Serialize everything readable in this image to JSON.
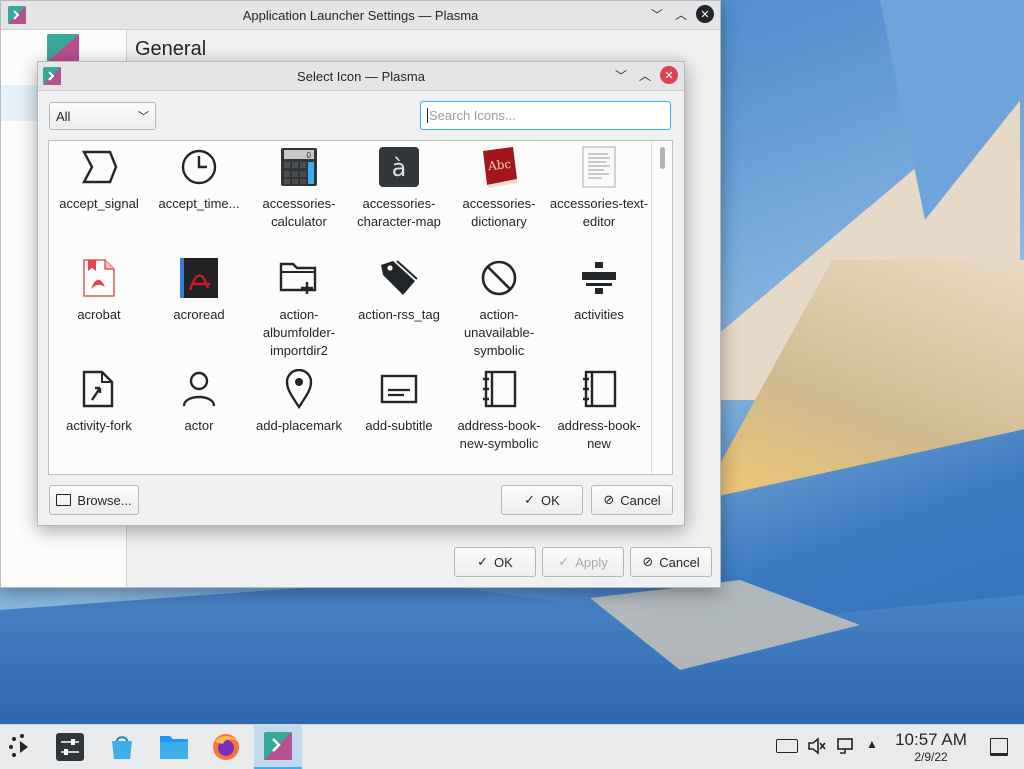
{
  "parent_window": {
    "title": "Application Launcher Settings — Plasma",
    "heading": "General",
    "ok_label": "OK",
    "apply_label": "Apply",
    "cancel_label": "Cancel"
  },
  "dialog": {
    "title": "Select Icon — Plasma",
    "category_selected": "All",
    "search_placeholder": "Search Icons...",
    "browse_label": "Browse...",
    "ok_label": "OK",
    "cancel_label": "Cancel",
    "icons": [
      {
        "label": "accept_signal",
        "icon": "sigma-icon"
      },
      {
        "label": "accept_time...",
        "icon": "clock-icon"
      },
      {
        "label": "accessories-calculator",
        "icon": "calculator-icon"
      },
      {
        "label": "accessories-character-map",
        "icon": "character-map-icon"
      },
      {
        "label": "accessories-dictionary",
        "icon": "dictionary-icon"
      },
      {
        "label": "accessories-text-editor",
        "icon": "text-editor-icon"
      },
      {
        "label": "acrobat",
        "icon": "acrobat-icon"
      },
      {
        "label": "acroread",
        "icon": "acroread-icon"
      },
      {
        "label": "action-albumfolder-importdir2",
        "icon": "folder-add-icon"
      },
      {
        "label": "action-rss_tag",
        "icon": "tag-icon"
      },
      {
        "label": "action-unavailable-symbolic",
        "icon": "unavailable-icon"
      },
      {
        "label": "activities",
        "icon": "activities-icon"
      },
      {
        "label": "activity-fork",
        "icon": "file-fork-icon"
      },
      {
        "label": "actor",
        "icon": "person-icon"
      },
      {
        "label": "add-placemark",
        "icon": "placemark-icon"
      },
      {
        "label": "add-subtitle",
        "icon": "subtitle-icon"
      },
      {
        "label": "address-book-new-symbolic",
        "icon": "address-book-icon"
      },
      {
        "label": "address-book-new",
        "icon": "address-book-icon"
      }
    ]
  },
  "taskbar": {
    "clock_time": "10:57 AM",
    "clock_date": "2/9/22",
    "apps": [
      "application-launcher-icon",
      "system-settings-icon",
      "discover-icon",
      "dolphin-folder-icon",
      "firefox-icon",
      "plasma-settings-icon"
    ]
  }
}
